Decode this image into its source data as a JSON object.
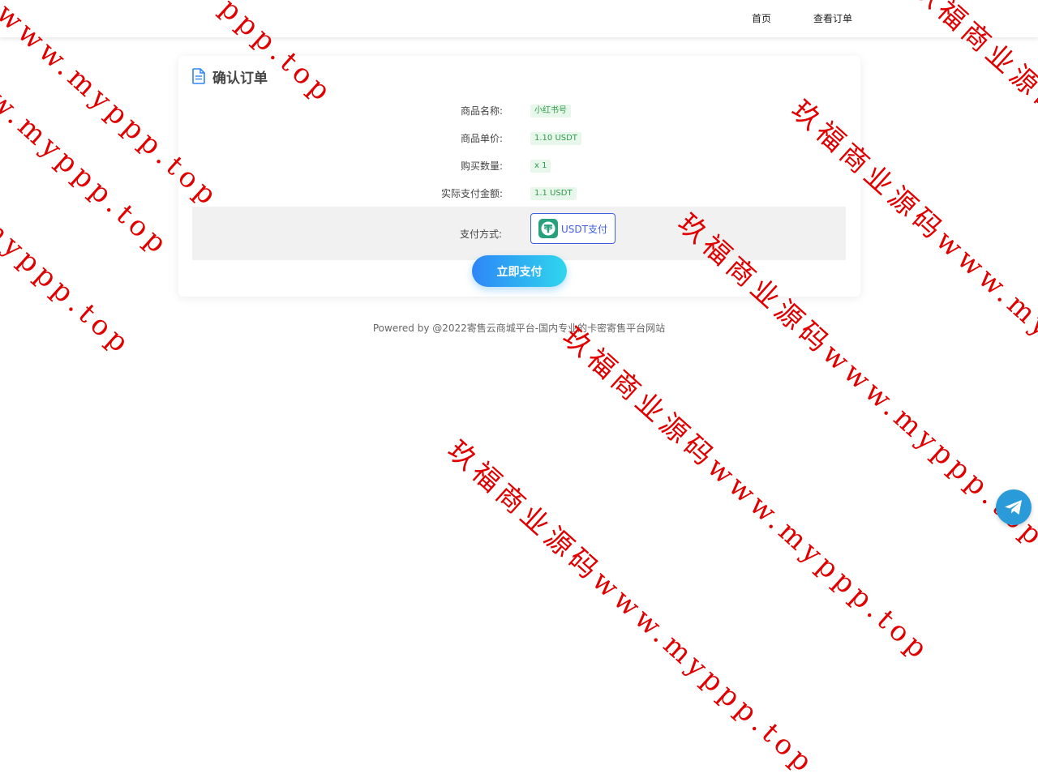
{
  "nav": {
    "home": "首页",
    "orders": "查看订单"
  },
  "order": {
    "title": "确认订单",
    "rows": [
      {
        "label": "商品名称:",
        "value": "小红书号"
      },
      {
        "label": "商品单价:",
        "value": "1.10 USDT"
      },
      {
        "label": "购买数量:",
        "value": "x 1"
      },
      {
        "label": "实际支付金额:",
        "value": "1.1 USDT"
      }
    ],
    "payment_method_label": "支付方式:",
    "payment_option": "USDT支付",
    "pay_button": "立即支付"
  },
  "footer": "Powered by @2022寄售云商城平台-国内专业的卡密寄售平台网站",
  "watermarks": [
    "码www.myppp.top",
    "ppp.top",
    "玖福商业源码www.myppp.top",
    "玖福商业源码www.myppp.top",
    "玖福商业源码www.myppp.top",
    "玖福商业源码www.myppp.top",
    "玖福商业源码www.myppp.top",
    "myppp.top",
    "玖福商业源码www.myppp.top"
  ],
  "colors": {
    "accent": "#2e86f7",
    "tag_bg": "#e8f7ec",
    "tag_text": "#2e9a49",
    "option_border": "#3f5fe0",
    "watermark": "#e00000",
    "telegram": "#2a9bd8"
  },
  "icons": {
    "title": "document-icon",
    "payment": "tether-usdt-icon",
    "float": "telegram-icon"
  }
}
